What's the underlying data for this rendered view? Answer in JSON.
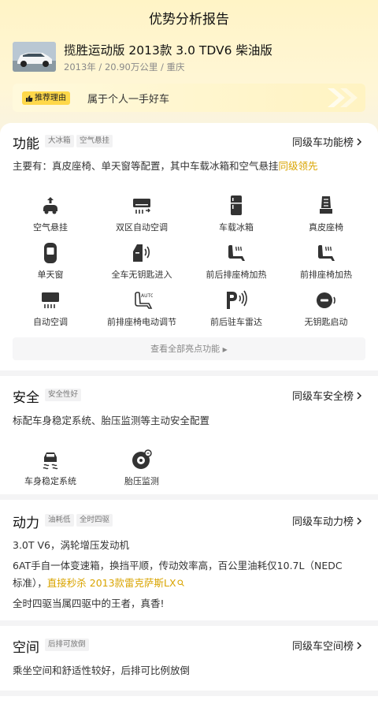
{
  "header": {
    "title": "优势分析报告"
  },
  "car": {
    "title": "揽胜运动版 2013款 3.0 TDV6 柴油版",
    "meta": "2013年 / 20.90万公里 / 重庆",
    "reason_tag": "推荐理由",
    "reason_text": "属于个人一手好车"
  },
  "features_section": {
    "title": "功能",
    "tags": [
      "大冰箱",
      "空气悬挂"
    ],
    "rank_link": "同级车功能榜",
    "summary_prefix": "主要有：真皮座椅、单天窗等配置，其中车载冰箱和空气悬挂",
    "summary_highlight": "同级领先",
    "items": [
      {
        "label": "空气悬挂",
        "icon": "air-suspension-icon"
      },
      {
        "label": "双区自动空调",
        "icon": "dual-zone-ac-icon"
      },
      {
        "label": "车载冰箱",
        "icon": "fridge-icon"
      },
      {
        "label": "真皮座椅",
        "icon": "leather-seat-icon"
      },
      {
        "label": "单天窗",
        "icon": "sunroof-icon"
      },
      {
        "label": "全车无钥匙进入",
        "icon": "keyless-entry-icon"
      },
      {
        "label": "前后排座椅加热",
        "icon": "seat-heating-icon"
      },
      {
        "label": "前排座椅加热",
        "icon": "front-seat-heating-icon"
      },
      {
        "label": "自动空调",
        "icon": "auto-ac-icon"
      },
      {
        "label": "前排座椅电动调节",
        "icon": "power-seat-icon"
      },
      {
        "label": "前后驻车雷达",
        "icon": "parking-radar-icon"
      },
      {
        "label": "无钥匙启动",
        "icon": "push-start-icon"
      }
    ],
    "view_all": "查看全部亮点功能"
  },
  "safety_section": {
    "title": "安全",
    "tags": [
      "安全性好"
    ],
    "rank_link": "同级车安全榜",
    "summary": "标配车身稳定系统、胎压监测等主动安全配置",
    "items": [
      {
        "label": "车身稳定系统",
        "icon": "esp-icon"
      },
      {
        "label": "胎压监测",
        "icon": "tire-pressure-icon"
      }
    ]
  },
  "power_section": {
    "title": "动力",
    "tags": [
      "油耗低",
      "全时四驱"
    ],
    "rank_link": "同级车动力榜",
    "line1": "3.0T V6，涡轮增压发动机",
    "line2a": "6AT手自一体变速箱，换挡平顺，传动效率高，百公里油耗仅10.7L（NEDC",
    "line2b": "标准），",
    "line2_highlight": "直接秒杀 2013款雷克萨斯LX",
    "line3": "全时四驱当属四驱中的王者，真香!"
  },
  "space_section": {
    "title": "空间",
    "tags": [
      "后排可放倒"
    ],
    "rank_link": "同级车空间榜",
    "summary": "乘坐空间和舒适性较好，后排可比例放倒"
  },
  "colors": {
    "accent": "#d9a400",
    "tag_yellow": "#ffd84a"
  }
}
